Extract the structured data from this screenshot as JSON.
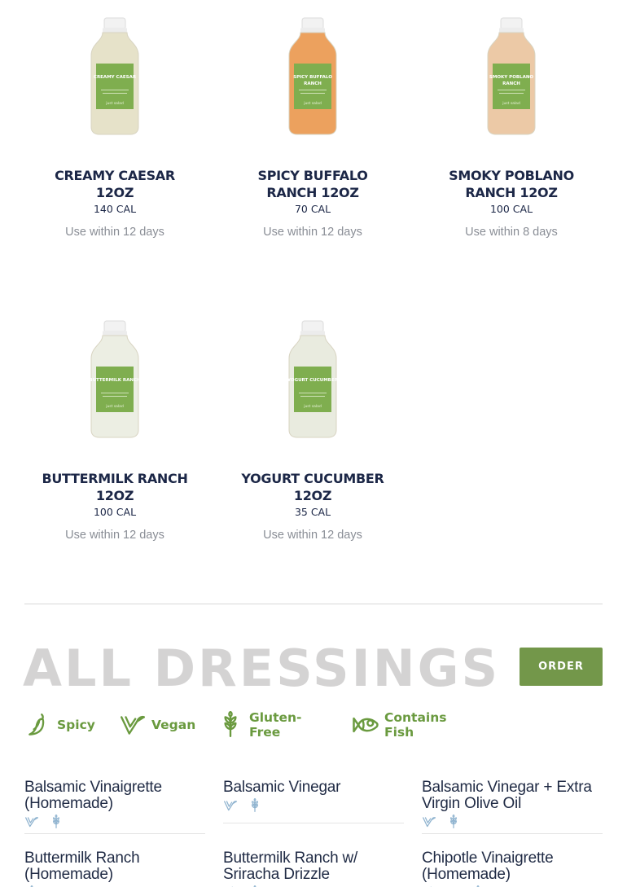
{
  "products": [
    {
      "name": "Creamy Caesar 12oz",
      "calories": "140 CAL",
      "use_within": "Use within 12 days",
      "color": "#e6e2c9",
      "label_text": "CREAMY CAESAR"
    },
    {
      "name": "Spicy Buffalo Ranch 12oz",
      "calories": "70 CAL",
      "use_within": "Use within 12 days",
      "color": "#eca15e",
      "label_text": "SPICY BUFFALO RANCH"
    },
    {
      "name": "Smoky Poblano Ranch 12oz",
      "calories": "100 CAL",
      "use_within": "Use within 8 days",
      "color": "#ecc9a6",
      "label_text": "SMOKY POBLANO RANCH"
    },
    {
      "name": "Buttermilk Ranch 12oz",
      "calories": "100 CAL",
      "use_within": "Use within 12 days",
      "color": "#eceee3",
      "label_text": "BUTTERMILK RANCH"
    },
    {
      "name": "Yogurt Cucumber 12oz",
      "calories": "35 CAL",
      "use_within": "Use within 12 days",
      "color": "#e9ebdf",
      "label_text": "YOGURT CUCUMBER"
    }
  ],
  "all_dressings": {
    "title": "ALL DRESSINGS",
    "order_label": "ORDER"
  },
  "legend": [
    {
      "label": "Spicy",
      "icon": "pepper-icon"
    },
    {
      "label": "Vegan",
      "icon": "vegan-icon"
    },
    {
      "label": "Gluten-Free",
      "icon": "wheat-icon"
    },
    {
      "label": "Contains Fish",
      "icon": "fish-icon"
    }
  ],
  "dressings": [
    {
      "name": "Balsamic Vinaigrette (Homemade)",
      "icons": [
        "vegan-icon",
        "wheat-icon"
      ]
    },
    {
      "name": "Balsamic Vinegar",
      "icons": [
        "vegan-icon",
        "wheat-icon"
      ]
    },
    {
      "name": "Balsamic Vinegar + Extra Virgin Olive Oil",
      "icons": [
        "vegan-icon",
        "wheat-icon"
      ]
    },
    {
      "name": "Buttermilk Ranch (Homemade)",
      "icons": [
        "wheat-icon"
      ]
    },
    {
      "name": "Buttermilk Ranch w/ Sriracha Drizzle",
      "icons": [
        "pepper-icon",
        "wheat-icon"
      ]
    },
    {
      "name": "Chipotle Vinaigrette (Homemade)",
      "icons": [
        "pepper-icon",
        "vegan-icon",
        "wheat-icon"
      ]
    }
  ],
  "colors": {
    "accent_green": "#73974a",
    "icon_green": "#6a9a3f",
    "icon_blue": "#8fb3cf",
    "navy_text": "#1c2747",
    "muted_gray": "#8a8e96",
    "title_gray": "#d4d3d3"
  }
}
